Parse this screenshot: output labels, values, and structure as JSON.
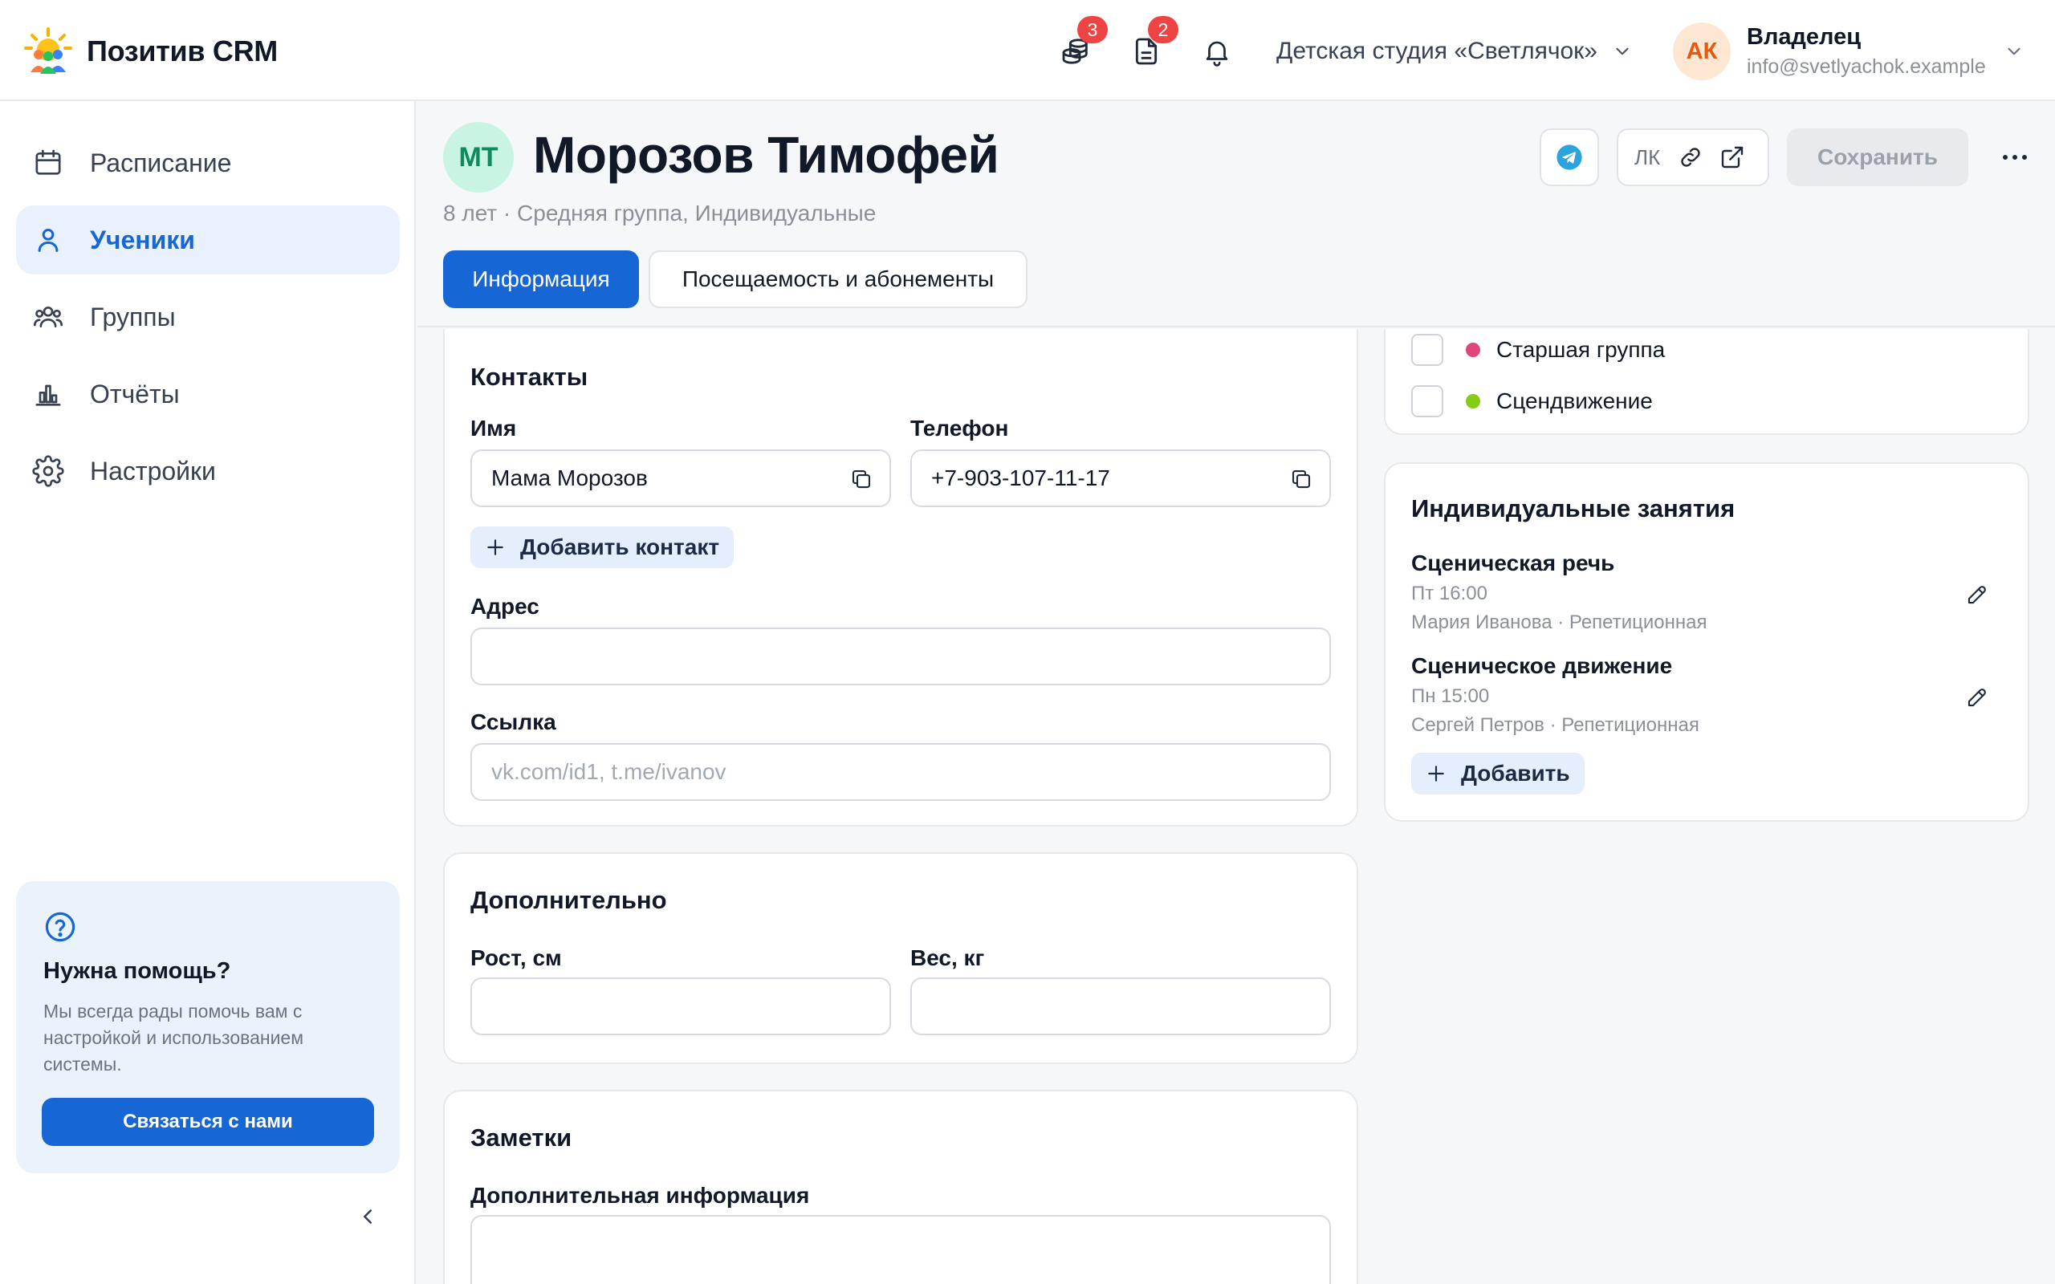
{
  "app": {
    "brand_name": "Позитив CRM",
    "accent_color": "#1766d6"
  },
  "topbar": {
    "payments_badge": "3",
    "documents_badge": "2",
    "studio_name": "Детская студия «Светлячок»",
    "user": {
      "initials": "АК",
      "role": "Владелец",
      "email": "info@svetlyachok.example"
    }
  },
  "sidebar": {
    "items": [
      {
        "label": "Расписание",
        "icon": "calendar-icon",
        "active": false
      },
      {
        "label": "Ученики",
        "icon": "user-icon",
        "active": true
      },
      {
        "label": "Группы",
        "icon": "users-icon",
        "active": false
      },
      {
        "label": "Отчёты",
        "icon": "chart-icon",
        "active": false
      },
      {
        "label": "Настройки",
        "icon": "gear-icon",
        "active": false
      }
    ],
    "help": {
      "title": "Нужна помощь?",
      "text": "Мы всегда рады помочь вам с настройкой и использованием системы.",
      "button": "Связаться с нами"
    }
  },
  "student": {
    "initials": "МТ",
    "name": "Морозов Тимофей",
    "subtitle": "8 лет · Средняя группа, Индивидуальные"
  },
  "header_actions": {
    "lk_label": "ЛК",
    "save_label": "Сохранить"
  },
  "tabs": [
    {
      "label": "Информация",
      "active": true
    },
    {
      "label": "Посещаемость и абонементы",
      "active": false
    }
  ],
  "contacts": {
    "title": "Контакты",
    "name_label": "Имя",
    "name_value": "Мама Морозов",
    "phone_label": "Телефон",
    "phone_value": "+7-903-107-11-17",
    "add_contact": "Добавить контакт",
    "address_label": "Адрес",
    "address_value": "",
    "link_label": "Ссылка",
    "link_placeholder": "vk.com/id1, t.me/ivanov"
  },
  "additional": {
    "title": "Дополнительно",
    "height_label": "Рост, см",
    "height_value": "",
    "weight_label": "Вес, кг",
    "weight_value": ""
  },
  "notes": {
    "title": "Заметки",
    "info_label": "Дополнительная информация",
    "info_value": ""
  },
  "groups": {
    "items": [
      {
        "name": "Старшая группа",
        "color": "#e0457b",
        "checked": false
      },
      {
        "name": "Сцендвижение",
        "color": "#84cc16",
        "checked": false
      }
    ]
  },
  "individual": {
    "title": "Индивидуальные занятия",
    "lessons": [
      {
        "title": "Сценическая речь",
        "time": "Пт 16:00",
        "meta": "Мария Иванова · Репетиционная"
      },
      {
        "title": "Сценическое движение",
        "time": "Пн 15:00",
        "meta": "Сергей Петров · Репетиционная"
      }
    ],
    "add_label": "Добавить"
  }
}
